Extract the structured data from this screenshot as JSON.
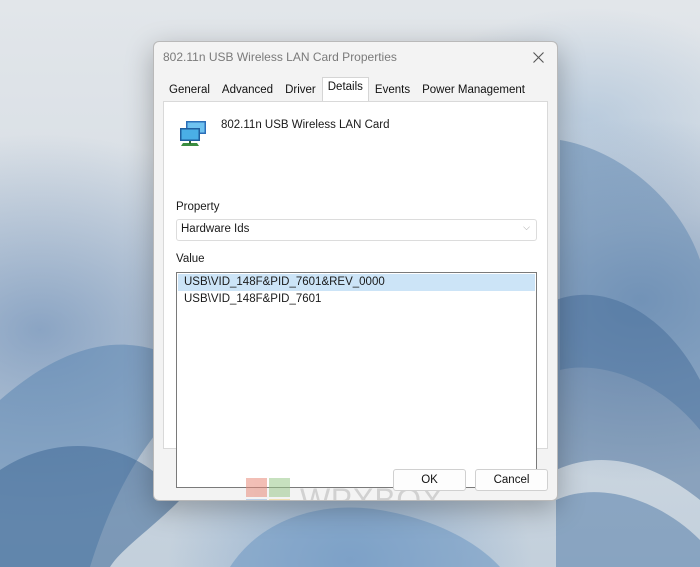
{
  "dialog": {
    "title": "802.11n USB Wireless LAN Card Properties",
    "tabs": [
      {
        "label": "General"
      },
      {
        "label": "Advanced"
      },
      {
        "label": "Driver"
      },
      {
        "label": "Details"
      },
      {
        "label": "Events"
      },
      {
        "label": "Power Management"
      }
    ],
    "active_tab": "Details",
    "device_name": "802.11n USB Wireless LAN Card",
    "device_icon": "network-adapter-icon",
    "property_label": "Property",
    "property_selected": "Hardware Ids",
    "value_label": "Value",
    "values": [
      {
        "text": "USB\\VID_148F&PID_7601&REV_0000",
        "selected": true
      },
      {
        "text": "USB\\VID_148F&PID_7601",
        "selected": false
      }
    ],
    "watermark": {
      "brand": "WPXBOX"
    },
    "ok_label": "OK",
    "cancel_label": "Cancel"
  },
  "colors": {
    "selection": "#cce4f7",
    "dialog_bg": "#f3f3f3"
  }
}
